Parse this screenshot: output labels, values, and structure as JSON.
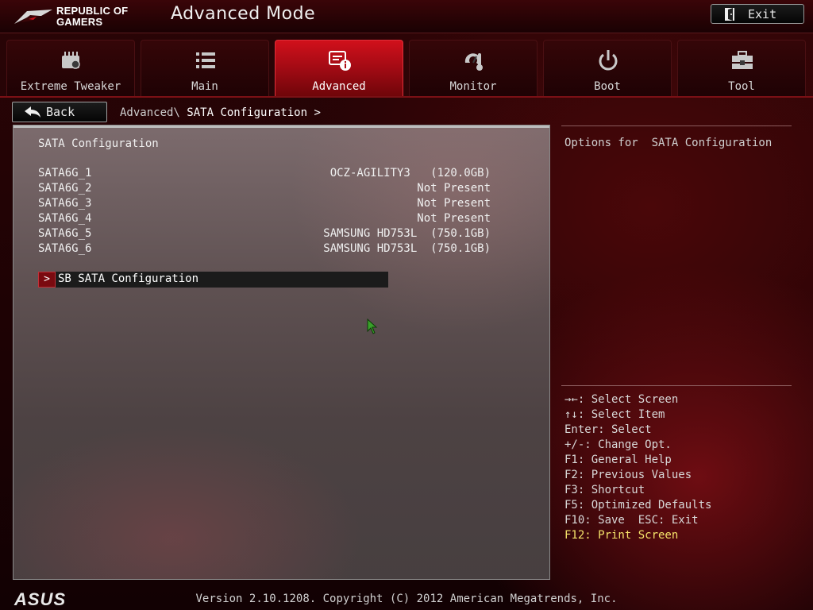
{
  "header": {
    "brand": "REPUBLIC OF GAMERS",
    "brand_line1": "REPUBLIC OF",
    "brand_line2": "GAMERS",
    "mode_title": "Advanced Mode",
    "exit_label": "Exit"
  },
  "tabs": [
    {
      "label": "Extreme Tweaker",
      "icon": "tweaker-icon",
      "active": false
    },
    {
      "label": "Main",
      "icon": "list-icon",
      "active": false
    },
    {
      "label": "Advanced",
      "icon": "advanced-icon",
      "active": true
    },
    {
      "label": "Monitor",
      "icon": "monitor-icon",
      "active": false
    },
    {
      "label": "Boot",
      "icon": "power-icon",
      "active": false
    },
    {
      "label": "Tool",
      "icon": "toolbox-icon",
      "active": false
    }
  ],
  "nav": {
    "back_label": "Back",
    "breadcrumb_parent": "Advanced\\",
    "breadcrumb_current": "SATA Configuration >"
  },
  "main": {
    "section_title": "SATA Configuration",
    "ports": [
      {
        "name": "SATA6G_1",
        "value": "OCZ-AGILITY3   (120.0GB)"
      },
      {
        "name": "SATA6G_2",
        "value": "Not Present"
      },
      {
        "name": "SATA6G_3",
        "value": "Not Present"
      },
      {
        "name": "SATA6G_4",
        "value": "Not Present"
      },
      {
        "name": "SATA6G_5",
        "value": "SAMSUNG HD753L  (750.1GB)"
      },
      {
        "name": "SATA6G_6",
        "value": "SAMSUNG HD753L  (750.1GB)"
      }
    ],
    "submenu_arrow": ">",
    "submenu_label": "SB SATA Configuration"
  },
  "help": {
    "title": "Options for  SATA Configuration",
    "keys": [
      "→←: Select Screen",
      "↑↓: Select Item",
      "Enter: Select",
      "+/-: Change Opt.",
      "F1: General Help",
      "F2: Previous Values",
      "F3: Shortcut",
      "F5: Optimized Defaults",
      "F10: Save  ESC: Exit",
      "F12: Print Screen"
    ],
    "highlight_color": "#f5e36a"
  },
  "footer": {
    "logo": "ASUS",
    "version": "Version 2.10.1208. Copyright (C) 2012 American Megatrends, Inc."
  },
  "colors": {
    "accent": "#c8101a",
    "background": "#1c0204",
    "panel": "#5f5152"
  }
}
